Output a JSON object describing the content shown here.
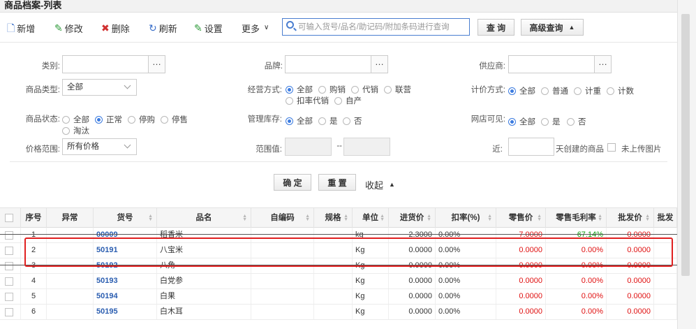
{
  "window": {
    "title": "商品档案-列表"
  },
  "toolbar": {
    "new": "新增",
    "edit": "修改",
    "delete": "删除",
    "refresh": "刷新",
    "settings": "设置",
    "more": "更多",
    "search_placeholder": "可输入货号/品名/助记码/附加条码进行查询",
    "query": "查 询",
    "advanced": "高级查询"
  },
  "filters": {
    "category_label": "类别:",
    "brand_label": "品牌:",
    "supplier_label": "供应商:",
    "type_label": "商品类型:",
    "type_value": "全部",
    "operation_label": "经营方式:",
    "operation_options": [
      "全部",
      "购销",
      "代销",
      "联营",
      "扣率代销",
      "自产"
    ],
    "pricing_label": "计价方式:",
    "pricing_options": [
      "全部",
      "普通",
      "计重",
      "计数"
    ],
    "status_label": "商品状态:",
    "status_options": [
      "全部",
      "正常",
      "停购",
      "停售",
      "淘汰"
    ],
    "stock_label": "管理库存:",
    "stock_options": [
      "全部",
      "是",
      "否"
    ],
    "web_label": "网店可见:",
    "web_options": [
      "全部",
      "是",
      "否"
    ],
    "price_range_label": "价格范围:",
    "price_range_value": "所有价格",
    "range_value_label": "范围值:",
    "range_sep": "--",
    "recent_label": "近:",
    "recent_suffix": "天创建的商品",
    "no_image_label": "未上传图片",
    "ok": "确 定",
    "reset": "重 置",
    "collapse": "收起"
  },
  "table": {
    "columns": [
      "序号",
      "异常",
      "货号",
      "品名",
      "自编码",
      "规格",
      "单位",
      "进货价",
      "扣率(%)",
      "零售价",
      "零售毛利率",
      "批发价",
      "批发"
    ],
    "rows": [
      {
        "no": "1",
        "code": "00009",
        "name": "稻香米",
        "unit": "kg",
        "cost": "2.3000",
        "rate": "0.00%",
        "retail": "7.0000",
        "margin": "67.14%",
        "wholesale": "0.0000",
        "struck": true
      },
      {
        "no": "2",
        "code": "50191",
        "name": "八宝米",
        "unit": "Kg",
        "cost": "0.0000",
        "rate": "0.00%",
        "retail": "0.0000",
        "margin": "0.00%",
        "wholesale": "0.0000",
        "struck": false
      },
      {
        "no": "3",
        "code": "50192",
        "name": "八角",
        "unit": "Kg",
        "cost": "0.0000",
        "rate": "0.00%",
        "retail": "0.0000",
        "margin": "0.00%",
        "wholesale": "0.0000",
        "struck": true
      },
      {
        "no": "4",
        "code": "50193",
        "name": "白党参",
        "unit": "Kg",
        "cost": "0.0000",
        "rate": "0.00%",
        "retail": "0.0000",
        "margin": "0.00%",
        "wholesale": "0.0000",
        "struck": false
      },
      {
        "no": "5",
        "code": "50194",
        "name": "白果",
        "unit": "Kg",
        "cost": "0.0000",
        "rate": "0.00%",
        "retail": "0.0000",
        "margin": "0.00%",
        "wholesale": "0.0000",
        "struck": false
      },
      {
        "no": "6",
        "code": "50195",
        "name": "白木耳",
        "unit": "Kg",
        "cost": "0.0000",
        "rate": "0.00%",
        "retail": "0.0000",
        "margin": "0.00%",
        "wholesale": "0.0000",
        "struck": false
      }
    ]
  },
  "colors": {
    "accent": "#3b7be0",
    "red": "#e01010",
    "green": "#0a9a0a",
    "code": "#2a5db0"
  }
}
